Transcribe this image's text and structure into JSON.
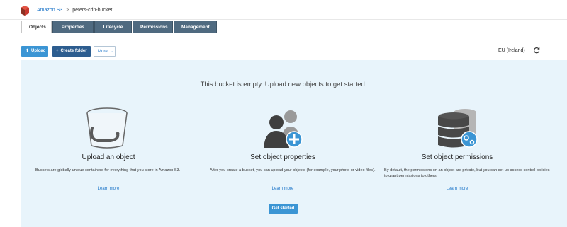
{
  "breadcrumb": {
    "root": "Amazon S3",
    "separator": ">",
    "bucket": "peters-cdn-bucket"
  },
  "tabs": [
    {
      "label": "Objects",
      "active": true
    },
    {
      "label": "Properties",
      "active": false
    },
    {
      "label": "Lifecycle",
      "active": false
    },
    {
      "label": "Permissions",
      "active": false
    },
    {
      "label": "Management",
      "active": false
    }
  ],
  "toolbar": {
    "upload_label": "Upload",
    "upload_icon": "upload-icon",
    "create_folder_label": "Create folder",
    "create_folder_icon": "plus-icon",
    "more_label": "More",
    "more_icon": "chevron-down-icon",
    "region": "EU (Ireland)",
    "refresh_icon": "refresh-icon"
  },
  "empty_state": {
    "message": "This bucket is empty. Upload new objects to get started.",
    "cards": [
      {
        "title": "Upload an object",
        "description": "Buckets are globally unique containers for everything that you store in Amazon S3.",
        "link": "Learn more",
        "icon": "bucket-icon"
      },
      {
        "title": "Set object properties",
        "description": "After you create a bucket, you can upload your objects (for example, your photo or video files).",
        "link": "Learn more",
        "icon": "users-add-icon"
      },
      {
        "title": "Set object permissions",
        "description": "By default, the permissions on an object are private, but you can set up access control policies to grant permissions to others.",
        "link": "Learn more",
        "icon": "database-settings-icon"
      }
    ],
    "get_started_label": "Get started"
  },
  "colors": {
    "accent": "#3b95d4",
    "dark_button": "#2d5d8f",
    "tab_inactive": "#4f6a80",
    "panel_bg": "#e8f4fb",
    "link": "#1a73c8"
  }
}
